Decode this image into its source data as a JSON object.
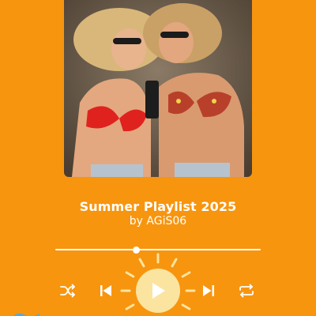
{
  "player": {
    "title": "Summer Playlist 2025",
    "artist": "by AGiS06",
    "progress_fraction": 0.394
  },
  "icons": {
    "shuffle": "shuffle-icon",
    "previous": "skip-previous-icon",
    "play": "play-icon",
    "next": "skip-next-icon",
    "repeat": "repeat-icon",
    "sun": "sun-rays-decoration"
  },
  "colors": {
    "background": "#F7950F",
    "foreground": "#FFFFFF",
    "play_button": "#FBE4A0",
    "sun_rays": "#FBE4A0"
  }
}
